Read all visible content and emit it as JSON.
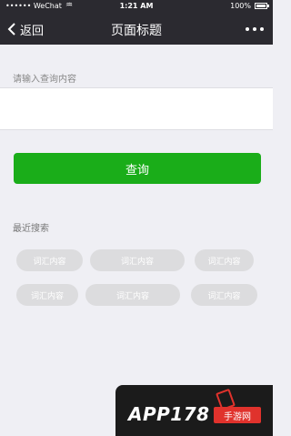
{
  "status_bar": {
    "carrier": "•••••• WeChat",
    "wifi_icon": "wifi-icon",
    "time": "1:21 AM",
    "battery": "100%"
  },
  "nav": {
    "back_label": "返回",
    "title": "页面标题",
    "more_icon": "more-dots-icon"
  },
  "search": {
    "label": "请输入查询内容",
    "value": "",
    "placeholder": ""
  },
  "query_button": {
    "label": "查询",
    "color": "#1aad19"
  },
  "recent": {
    "label": "最近搜索",
    "chips": [
      "词汇内容",
      "词汇内容",
      "词汇内容",
      "词汇内容",
      "词汇内容",
      "词汇内容"
    ]
  },
  "watermark": {
    "text": "APP178",
    "cn": "手游网"
  }
}
